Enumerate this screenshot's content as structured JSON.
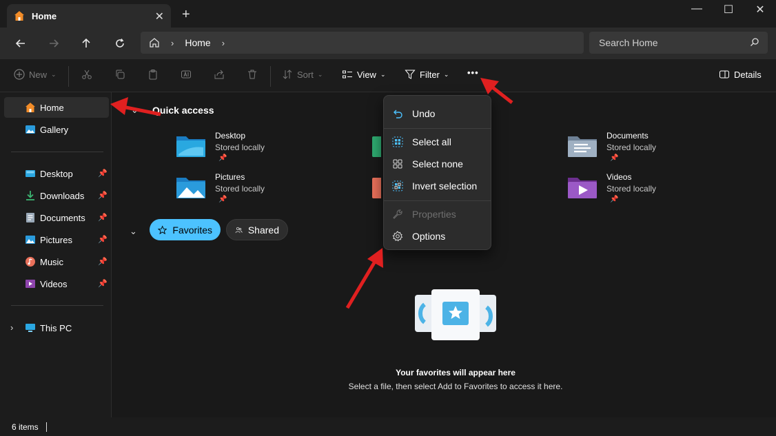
{
  "window": {
    "tab_title": "Home",
    "tab_close": "✕",
    "new_tab": "+",
    "minimize": "—",
    "maximize": "☐",
    "close": "✕"
  },
  "nav": {
    "breadcrumb": [
      "Home"
    ],
    "search_placeholder": "Search Home"
  },
  "toolbar": {
    "new_label": "New",
    "sort_label": "Sort",
    "view_label": "View",
    "filter_label": "Filter",
    "more_label": "•••",
    "details_label": "Details"
  },
  "sidebar": {
    "top_items": [
      {
        "label": "Home",
        "icon": "home-icon"
      },
      {
        "label": "Gallery",
        "icon": "gallery-icon"
      }
    ],
    "pinned_items": [
      {
        "label": "Desktop",
        "icon": "desktop-icon"
      },
      {
        "label": "Downloads",
        "icon": "downloads-icon"
      },
      {
        "label": "Documents",
        "icon": "documents-icon"
      },
      {
        "label": "Pictures",
        "icon": "pictures-icon"
      },
      {
        "label": "Music",
        "icon": "music-icon"
      },
      {
        "label": "Videos",
        "icon": "videos-icon"
      }
    ],
    "this_pc": "This PC"
  },
  "quick_access": {
    "title": "Quick access",
    "items": [
      {
        "name": "Desktop",
        "status": "Stored locally",
        "color": "#29a8e0"
      },
      {
        "name": "Documents",
        "status": "Stored locally",
        "color": "#8fa3b8"
      },
      {
        "name": "Pictures",
        "status": "Stored locally",
        "color": "#2a9bdc"
      },
      {
        "name": "Videos",
        "status": "Stored locally",
        "color": "#8e44ad"
      }
    ]
  },
  "filters": {
    "favorites": "Favorites",
    "shared": "Shared"
  },
  "menu": {
    "undo": "Undo",
    "select_all": "Select all",
    "select_none": "Select none",
    "invert_selection": "Invert selection",
    "properties": "Properties",
    "options": "Options"
  },
  "empty_state": {
    "title": "Your favorites will appear here",
    "subtitle": "Select a file, then select Add to Favorites to access it here."
  },
  "status": {
    "item_count": "6 items"
  },
  "colors": {
    "accent": "#4cc2ff",
    "annotation_arrow": "#e02020"
  }
}
